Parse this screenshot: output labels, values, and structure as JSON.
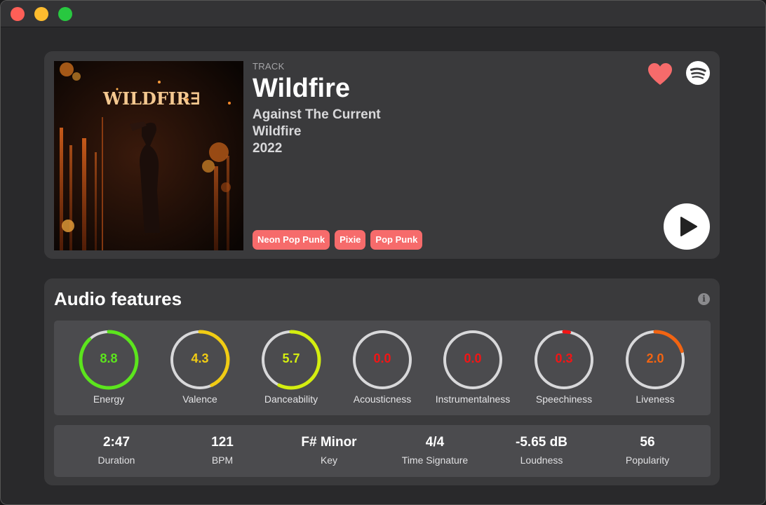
{
  "track": {
    "type_label": "TRACK",
    "title": "Wildfire",
    "artist": "Against The Current",
    "album": "Wildfire",
    "year": "2022",
    "cover_text": "WILDFIR∃",
    "tags": [
      "Neon Pop Punk",
      "Pixie",
      "Pop Punk"
    ],
    "liked": true,
    "icons": {
      "like": "heart-icon",
      "spotify": "spotify-icon",
      "play": "play-icon"
    },
    "colors": {
      "tag": "#f66b6b",
      "heart": "#f66b6b"
    }
  },
  "features": {
    "title": "Audio features",
    "info_icon": "i",
    "gauges": [
      {
        "label": "Energy",
        "value": "8.8",
        "fraction": 0.88,
        "color": "#5ce51d"
      },
      {
        "label": "Valence",
        "value": "4.3",
        "fraction": 0.43,
        "color": "#f1cc14"
      },
      {
        "label": "Danceability",
        "value": "5.7",
        "fraction": 0.57,
        "color": "#d4ee10"
      },
      {
        "label": "Acousticness",
        "value": "0.0",
        "fraction": 0.0,
        "color": "#f21515"
      },
      {
        "label": "Instrumentalness",
        "value": "0.0",
        "fraction": 0.0,
        "color": "#f21515"
      },
      {
        "label": "Speechiness",
        "value": "0.3",
        "fraction": 0.03,
        "color": "#f21515"
      },
      {
        "label": "Liveness",
        "value": "2.0",
        "fraction": 0.2,
        "color": "#f26412"
      }
    ],
    "stats": [
      {
        "label": "Duration",
        "value": "2:47"
      },
      {
        "label": "BPM",
        "value": "121"
      },
      {
        "label": "Key",
        "value": "F# Minor"
      },
      {
        "label": "Time Signature",
        "value": "4/4"
      },
      {
        "label": "Loudness",
        "value": "-5.65 dB"
      },
      {
        "label": "Popularity",
        "value": "56"
      }
    ]
  }
}
